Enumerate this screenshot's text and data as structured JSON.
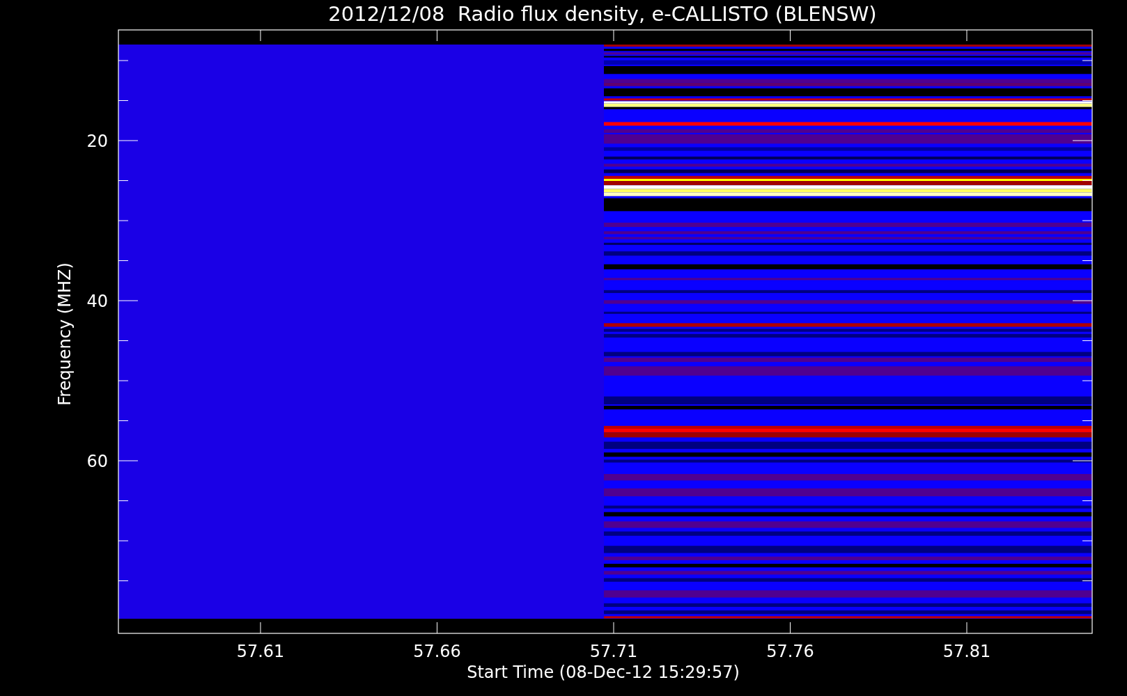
{
  "plot": {
    "title": "2012/12/08  Radio flux density, e-CALLISTO (BLENSW)",
    "xlabel": "Start Time (08-Dec-12 15:29:57)",
    "ylabel": "Frequency (MHZ)",
    "xticks": [
      "57.61",
      "57.66",
      "57.71",
      "57.76",
      "57.81"
    ],
    "yticks": [
      "20",
      "40",
      "60"
    ]
  }
}
